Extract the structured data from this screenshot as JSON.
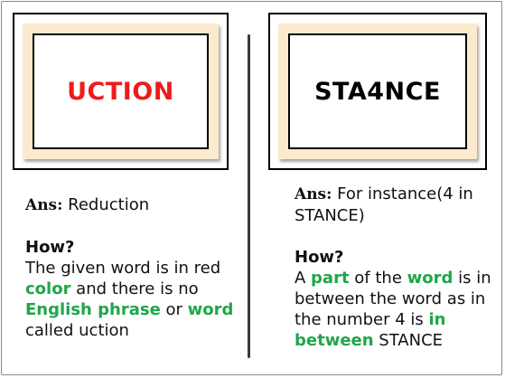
{
  "colors": {
    "accent_red": "#ee1c1c",
    "accent_green": "#1fa64a",
    "mat": "#fbeacb"
  },
  "left": {
    "card_word": "UCTION",
    "ans_label": "Ans:",
    "ans_text": " Reduction",
    "how_label": "How?",
    "explanation": {
      "t1": " The given word is in red ",
      "g1": "color",
      "t2": " and there is no ",
      "g2": "English phrase",
      "t3": " or ",
      "g3": "word",
      "t4": " called uction"
    }
  },
  "right": {
    "card_word": "STA4NCE",
    "ans_label": "Ans:",
    "ans_text": " For instance(4 in STANCE)",
    "how_label": "How?",
    "explanation": {
      "t1": " A ",
      "g1": "part",
      "t2": " of the ",
      "g2": "word",
      "t3": " is in between the  word as in the number 4 is ",
      "g3": "in between",
      "t4": " STANCE"
    }
  }
}
